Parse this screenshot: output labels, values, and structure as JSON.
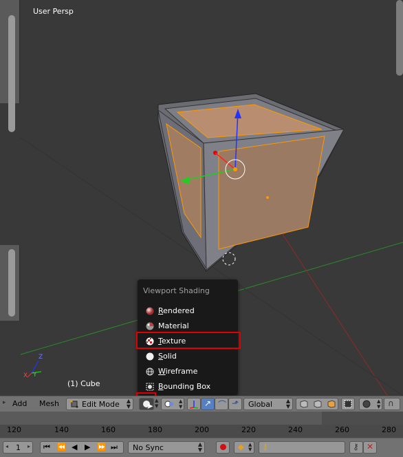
{
  "viewport": {
    "view_label": "User Persp",
    "object_label": "(1) Cube",
    "axis_widget": {
      "z": "Z",
      "y": "Y",
      "x": "X"
    }
  },
  "shading_menu": {
    "title": "Viewport Shading",
    "items": [
      {
        "label_u": "R",
        "label_rest": "endered",
        "icon": "rendered-sphere-icon",
        "highlighted": false
      },
      {
        "label_u": "",
        "label_rest": "Material",
        "icon": "material-sphere-icon",
        "highlighted": false
      },
      {
        "label_u": "T",
        "label_rest": "exture",
        "icon": "texture-checker-icon",
        "highlighted": true
      },
      {
        "label_u": "S",
        "label_rest": "olid",
        "icon": "solid-sphere-icon",
        "highlighted": false
      },
      {
        "label_u": "W",
        "label_rest": "ireframe",
        "icon": "wireframe-sphere-icon",
        "highlighted": false
      },
      {
        "label_u": "B",
        "label_rest": "ounding Box",
        "icon": "bounding-box-icon",
        "highlighted": false
      }
    ]
  },
  "header": {
    "menu_add": "Add",
    "menu_mesh": "Mesh",
    "mode": "Edit Mode",
    "orientation": "Global"
  },
  "timeline": {
    "ticks": [
      "120",
      "140",
      "160",
      "180",
      "200",
      "220",
      "240",
      "260",
      "280"
    ]
  },
  "bottom_bar": {
    "frame": "1",
    "sync": "No Sync"
  },
  "colors": {
    "highlight": "#e00000",
    "viewport_bg": "#393939",
    "face_fill": "#b08a6e",
    "edge_select": "#ff9900"
  }
}
